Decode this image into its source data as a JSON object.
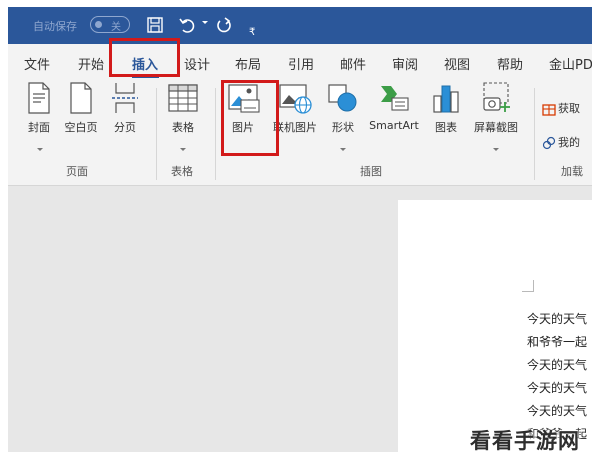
{
  "titlebar": {
    "autosave_label": "自动保存",
    "autosave_state": "关",
    "customize_symbol": "₹"
  },
  "tabs": [
    {
      "label": "文件"
    },
    {
      "label": "开始"
    },
    {
      "label": "插入",
      "active": true
    },
    {
      "label": "设计"
    },
    {
      "label": "布局"
    },
    {
      "label": "引用"
    },
    {
      "label": "邮件"
    },
    {
      "label": "审阅"
    },
    {
      "label": "视图"
    },
    {
      "label": "帮助"
    },
    {
      "label": "金山PD"
    }
  ],
  "ribbon": {
    "groups": {
      "pages": "页面",
      "tables": "表格",
      "illustrations": "插图",
      "addins": "加载"
    },
    "commands": {
      "cover": "封面",
      "blank_page": "空白页",
      "page_break": "分页",
      "table": "表格",
      "pictures": "图片",
      "online_pictures": "联机图片",
      "shapes": "形状",
      "smartart": "SmartArt",
      "chart": "图表",
      "screenshot": "屏幕截图",
      "get_addins": "获取",
      "my_addins": "我的"
    }
  },
  "document": {
    "lines": [
      "今天的天气",
      "和爷爷一起",
      "今天的天气",
      "今天的天气",
      "今天的天气",
      "和爷爷一起"
    ]
  },
  "watermark": "看看手游网",
  "colors": {
    "titlebar": "#2b579a",
    "active_tab": "#2b579a",
    "highlight": "#d21a1a",
    "ribbon_bg": "#f3f3f3",
    "doc_bg": "#e7e7e7"
  }
}
